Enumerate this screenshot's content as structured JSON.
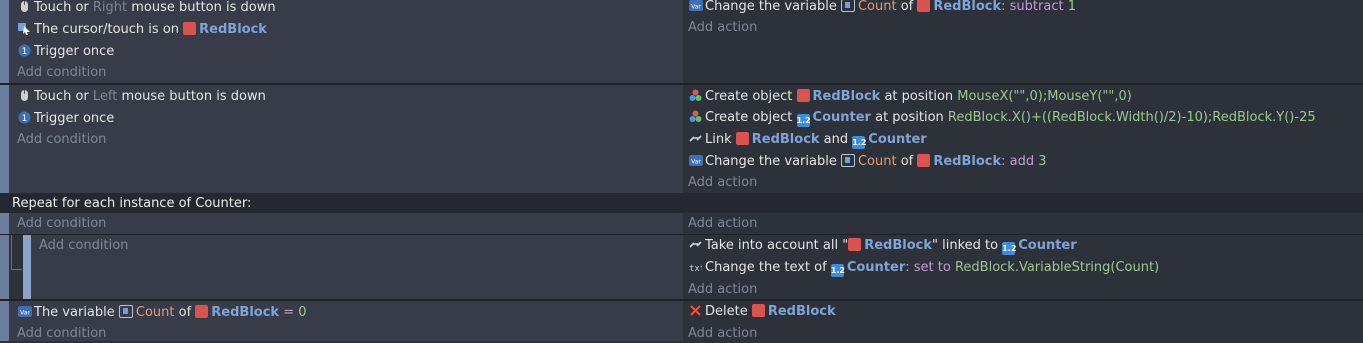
{
  "events": [
    {
      "conditions": [
        {
          "icon": "mouse-icon",
          "text": "Touch or ",
          "hl": "Right",
          "rest": " mouse button is down"
        },
        {
          "icon": "cursor-icon",
          "text": "The cursor/touch is on ",
          "obj": "RedBlock"
        },
        {
          "icon": "trigger-once-icon",
          "text": "Trigger once"
        }
      ],
      "add_condition": "Add condition",
      "actions": [
        {
          "icon": "variable-icon",
          "pre": "Change the variable ",
          "var": "Count",
          "mid": " of ",
          "obj": "RedBlock",
          "op": ": subtract ",
          "val": "1"
        }
      ],
      "add_action": "Add action"
    },
    {
      "conditions": [
        {
          "icon": "mouse-icon",
          "text": "Touch or ",
          "hl": "Left",
          "rest": " mouse button is down"
        },
        {
          "icon": "trigger-once-icon",
          "text": "Trigger once"
        }
      ],
      "add_condition": "Add condition",
      "actions": [
        {
          "icon": "create-object-icon",
          "pre": "Create object ",
          "obj": "RedBlock",
          "mid": " at position ",
          "expr": "MouseX(\"\",0);MouseY(\"\",0)"
        },
        {
          "icon": "create-object-icon",
          "pre": "Create object ",
          "obj": "Counter",
          "mid": " at position ",
          "expr": "RedBlock.X()+((RedBlock.Width()/2)-10);RedBlock.Y()-25"
        },
        {
          "icon": "link-icon",
          "pre": "Link ",
          "obj": "RedBlock",
          "mid": " and ",
          "obj2": "Counter"
        },
        {
          "icon": "variable-icon",
          "pre": "Change the variable ",
          "var": "Count",
          "mid": " of ",
          "obj": "RedBlock",
          "op": ": add ",
          "val": "3"
        }
      ],
      "add_action": "Add action"
    }
  ],
  "repeat": {
    "header": "Repeat for each instance of Counter:",
    "add_condition": "Add condition",
    "add_action": "Add action",
    "sub": {
      "add_condition": "Add condition",
      "actions": [
        {
          "pre": "Take into account all \"",
          "obj": "RedBlock",
          "mid": "\" linked to ",
          "obj2": "Counter"
        },
        {
          "pre": "Change the text of ",
          "obj": "Counter",
          "op": ": set to ",
          "expr": "RedBlock.VariableString(Count)"
        }
      ],
      "add_action": "Add action"
    }
  },
  "last": {
    "cond_pre": "The variable ",
    "cond_var": "Count",
    "cond_mid": " of ",
    "cond_obj": "RedBlock",
    "cond_op": " = ",
    "cond_val": "0",
    "add_condition": "Add condition",
    "action_pre": "Delete ",
    "action_obj": "RedBlock",
    "add_action": "Add action"
  },
  "counter_badge": "1.2"
}
